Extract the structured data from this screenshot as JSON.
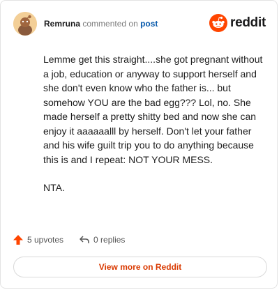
{
  "header": {
    "username": "Remruna",
    "action_text": "commented on",
    "post_link": "post",
    "brand": "reddit"
  },
  "comment": {
    "paragraphs": [
      "Lemme get this straight....she got pregnant without a job, education or anyway to support herself and she don't even know who the father is... but somehow YOU are the bad egg??? Lol, no. She made herself a pretty shitty bed and now she can enjoy it aaaaaalll by herself. Don't let your father and his wife guilt trip you to do anything because this is and I repeat: NOT YOUR MESS.",
      "NTA."
    ]
  },
  "actions": {
    "upvotes": "5 upvotes",
    "replies": "0 replies"
  },
  "footer": {
    "view_more": "View more on Reddit"
  },
  "colors": {
    "accent_orange": "#ff4500",
    "link_blue": "#0b5cad",
    "cta_text": "#d93900"
  },
  "icons": {
    "avatar": "snoo-avatar-icon",
    "logo": "reddit-logo-icon",
    "upvote": "upvote-arrow-icon",
    "reply": "reply-arrow-icon"
  }
}
